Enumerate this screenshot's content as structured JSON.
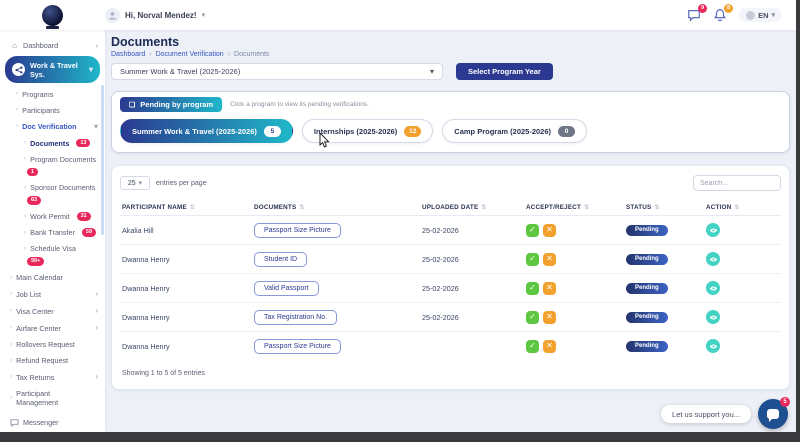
{
  "header": {
    "greeting": "Hi, Norval Mendez!",
    "language": "EN",
    "messages_badge": "9",
    "notifications_badge": "8"
  },
  "sidebar": {
    "items": [
      {
        "label": "Dashboard",
        "icon": "home"
      },
      {
        "label": "Work & Travel Sys.",
        "icon": "share",
        "active": true
      },
      {
        "label": "Programs"
      },
      {
        "label": "Participants"
      },
      {
        "label": "Doc Verification",
        "expanded": true
      },
      {
        "label": "Documents",
        "badge": "13",
        "current": true
      },
      {
        "label": "Program Documents",
        "badge": "1"
      },
      {
        "label": "Sponsor Documents",
        "badge": "63"
      },
      {
        "label": "Work Permit",
        "badge": "31"
      },
      {
        "label": "Bank Transfer",
        "badge": "59"
      },
      {
        "label": "Schedule Visa",
        "badge": "99+"
      },
      {
        "label": "Main Calendar"
      },
      {
        "label": "Job List"
      },
      {
        "label": "Visa Center"
      },
      {
        "label": "Airfare Center"
      },
      {
        "label": "Rollovers Request"
      },
      {
        "label": "Refund Request"
      },
      {
        "label": "Tax Returns"
      },
      {
        "label": "Participant Management"
      },
      {
        "label": "Messenger",
        "icon": "chat"
      }
    ]
  },
  "page": {
    "title": "Documents",
    "breadcrumb": [
      "Dashboard",
      "Document Verification",
      "Documents"
    ],
    "program_select": "Summer Work & Travel (2025-2026)",
    "select_button": "Select Program Year"
  },
  "programs_panel": {
    "chip_label": "Pending by program",
    "hint": "Click a program to view its pending verifications.",
    "pills": [
      {
        "label": "Summer Work & Travel (2025-2026)",
        "count": "5",
        "active": true
      },
      {
        "label": "Internships (2025-2026)",
        "count": "12",
        "active": false
      },
      {
        "label": "Camp Program (2025-2026)",
        "count": "0",
        "active": false
      }
    ]
  },
  "table": {
    "entries_per_page": "25",
    "entries_label": "entries per page",
    "search_placeholder": "Search...",
    "columns": [
      "PARTICIPANT NAME",
      "DOCUMENTS",
      "UPLOADED DATE",
      "ACCEPT/REJECT",
      "STATUS",
      "ACTION"
    ],
    "rows": [
      {
        "name": "Akalia Hill",
        "document": "Passport Size Picture",
        "date": "25-02-2026",
        "status": "Pending"
      },
      {
        "name": "Dwanna Henry",
        "document": "Student ID",
        "date": "25-02-2026",
        "status": "Pending"
      },
      {
        "name": "Dwanna Henry",
        "document": "Valid Passport",
        "date": "25-02-2026",
        "status": "Pending"
      },
      {
        "name": "Dwanna Henry",
        "document": "Tax Registration No.",
        "date": "25-02-2026",
        "status": "Pending"
      },
      {
        "name": "Dwanna Henry",
        "document": "Passport Size Picture",
        "date": "",
        "status": "Pending"
      }
    ],
    "summary": "Showing 1 to 5 of 5 entries"
  },
  "chat": {
    "label": "Let us support you...",
    "badge": "5"
  },
  "colors": {
    "accent_navy": "#2b3990",
    "accent_teal": "#1fb7c9",
    "badge_pink": "#e8285b",
    "accept_green": "#5ec742",
    "reject_orange": "#f2a12d",
    "action_teal": "#43d3c5",
    "link_blue": "#3756c0",
    "status_pill_navy": "#24346d"
  }
}
